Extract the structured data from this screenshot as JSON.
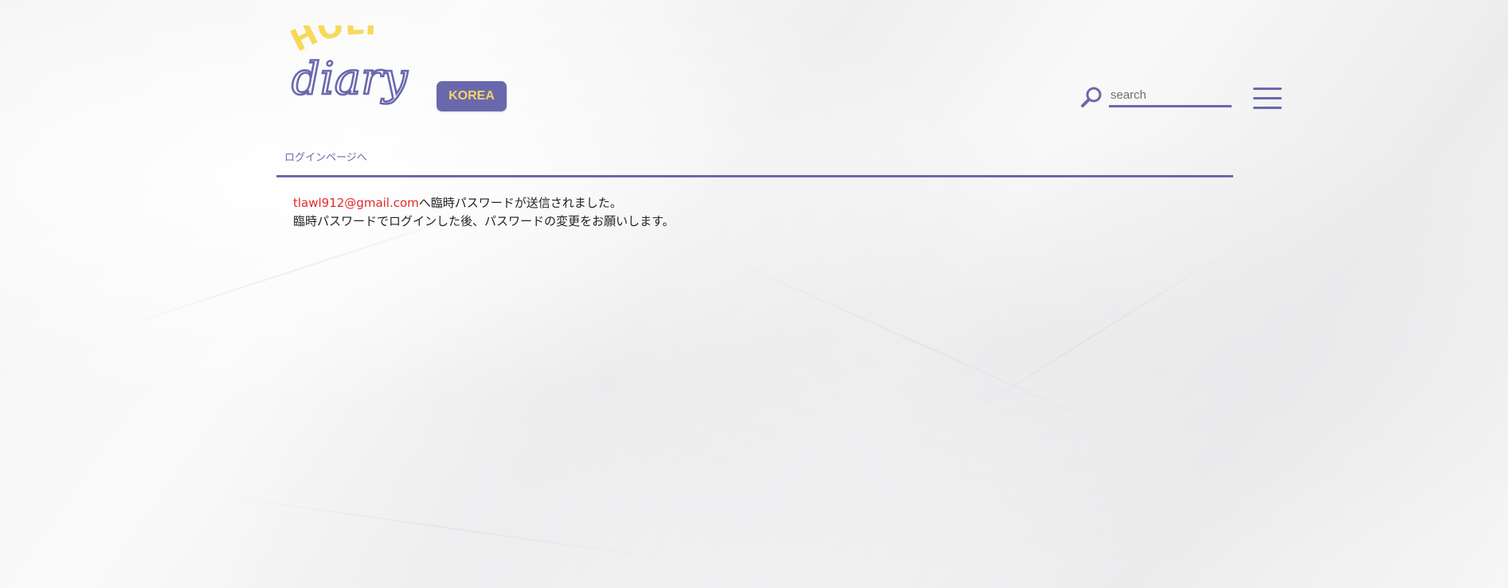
{
  "header": {
    "logo": {
      "top_word": "HOLI",
      "bottom_word": "diary",
      "colors": {
        "top": "#f7d95a",
        "bottom": "#6a68ad"
      }
    },
    "region_badge": "KOREA",
    "search": {
      "placeholder": "search",
      "value": ""
    },
    "icons": {
      "search": "search-icon",
      "menu": "hamburger-menu-icon"
    }
  },
  "breadcrumb": {
    "label": "ログインページへ"
  },
  "message": {
    "email": "tlawl912@gmail.com",
    "line1_suffix": "へ臨時パスワードが送信されました。",
    "line2": "臨時パスワードでログインした後、パスワードの変更をお願いします。"
  },
  "colors": {
    "accent": "#6a68ad",
    "logo_yellow": "#f7d95a",
    "email_red": "#e12b2b"
  }
}
